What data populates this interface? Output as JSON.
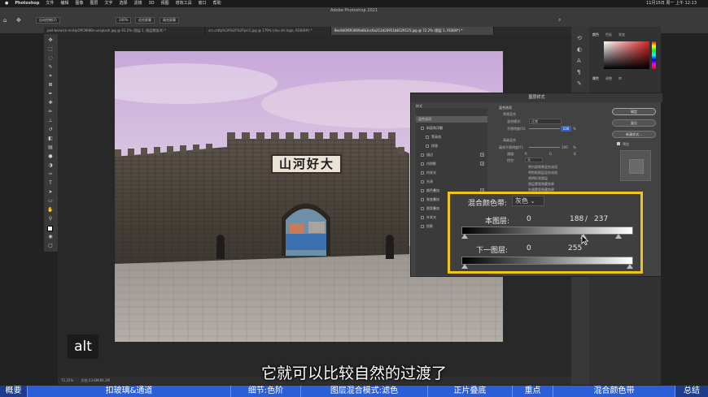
{
  "menubar": {
    "apple": "",
    "app": "Photoshop",
    "items": [
      "文件",
      "编辑",
      "图像",
      "图层",
      "文字",
      "选择",
      "滤镜",
      "3D",
      "视图",
      "增效工具",
      "窗口",
      "帮助"
    ],
    "clock": "11月15日 周一 上午 12:13"
  },
  "options": {
    "app_title": "Adobe Photoshop 2021",
    "auto_select": "自动控制(2)",
    "zoom": "100%",
    "fit_screen": "适合屏幕",
    "fill_screen": "填充屏幕"
  },
  "tabs": [
    "joel-barwick-mnHpOPCMl80e-unsplash.jpg @ 63.2% (图层 1, 图层蒙版/8) *",
    "src=http%3A%2F%2Fpic1.jpg @ 179% (shu zhi logo, RGB/8#) *",
    "8ec8d0f493069a6b3cc6a212d20951b8129125.jpg @ 72.2% (图层 1, RGB/8*) *"
  ],
  "statusbar": {
    "zoom": "72.22%",
    "doc": "文档:23.6M/84.2M"
  },
  "right_panel": {
    "tab_color": "颜色",
    "tab_swatch": "色板",
    "tab_grad": "渐变",
    "tab_props": "属性",
    "tab_adj": "调整",
    "tab_lib": "库"
  },
  "sign_text": "山河好大",
  "dialog": {
    "title": "图层样式",
    "styles_label": "样式",
    "items": [
      {
        "label": "混合选项",
        "checked": null,
        "plus": false,
        "active": true
      },
      {
        "label": "斜面和浮雕",
        "checked": false,
        "plus": false
      },
      {
        "label": "等高线",
        "checked": false,
        "plus": false
      },
      {
        "label": "纹理",
        "checked": false,
        "plus": false
      },
      {
        "label": "描边",
        "checked": false,
        "plus": true
      },
      {
        "label": "内阴影",
        "checked": false,
        "plus": true
      },
      {
        "label": "内发光",
        "checked": false,
        "plus": false
      },
      {
        "label": "光泽",
        "checked": false,
        "plus": false
      },
      {
        "label": "颜色叠加",
        "checked": false,
        "plus": true
      },
      {
        "label": "渐变叠加",
        "checked": false,
        "plus": true
      },
      {
        "label": "图案叠加",
        "checked": false,
        "plus": false
      },
      {
        "label": "外发光",
        "checked": false,
        "plus": false
      },
      {
        "label": "投影",
        "checked": false,
        "plus": true
      }
    ],
    "ok": "确定",
    "reset": "复位",
    "new_style": "新建样式...",
    "preview": "预览",
    "section_blend": "混合选项",
    "general_blend": "常规混合",
    "blend_mode_label": "混合模式:",
    "blend_mode": "正常",
    "opacity_label": "不透明度(O):",
    "opacity_value": "100",
    "pct": "%",
    "advanced_blend": "高级混合",
    "fill_opacity_label": "填充不透明度(F):",
    "fill_opacity_value": "100",
    "channels_label": "通道:",
    "ch_r": "R",
    "ch_g": "G",
    "ch_b": "B",
    "knockout_label": "挖空:",
    "knockout_value": "无",
    "adv_options": [
      "将内部效果混合成组",
      "将剪贴图层混合成组",
      "透明形状图层",
      "图层蒙版隐藏效果",
      "矢量蒙版隐藏效果"
    ]
  },
  "blend_if": {
    "label": "混合颜色带:",
    "channel": "灰色",
    "this_layer_label": "本图层:",
    "this_layer_black": "0",
    "this_layer_white_a": "188",
    "separator": "/",
    "this_layer_white_b": "237",
    "underlying_label": "下一图层:",
    "underlying_black": "0",
    "underlying_white": "255"
  },
  "alt_key": "alt",
  "subtitle": "它就可以比较自然的过渡了",
  "chapters": [
    {
      "label": "概要",
      "dark": true
    },
    {
      "label": "扣玻璃&通道",
      "dark": false
    },
    {
      "label": "细节:色阶",
      "dark": false
    },
    {
      "label": "图层混合模式:滤色",
      "dark": false
    },
    {
      "label": "正片叠底",
      "dark": false
    },
    {
      "label": "重点",
      "dark": false
    },
    {
      "label": "混合颜色带",
      "dark": false
    },
    {
      "label": "总结",
      "dark": true
    }
  ],
  "colors": {
    "highlight": "#f2c318",
    "chapter_bar": "#2b5fd9",
    "dialog_bg": "#424242"
  }
}
